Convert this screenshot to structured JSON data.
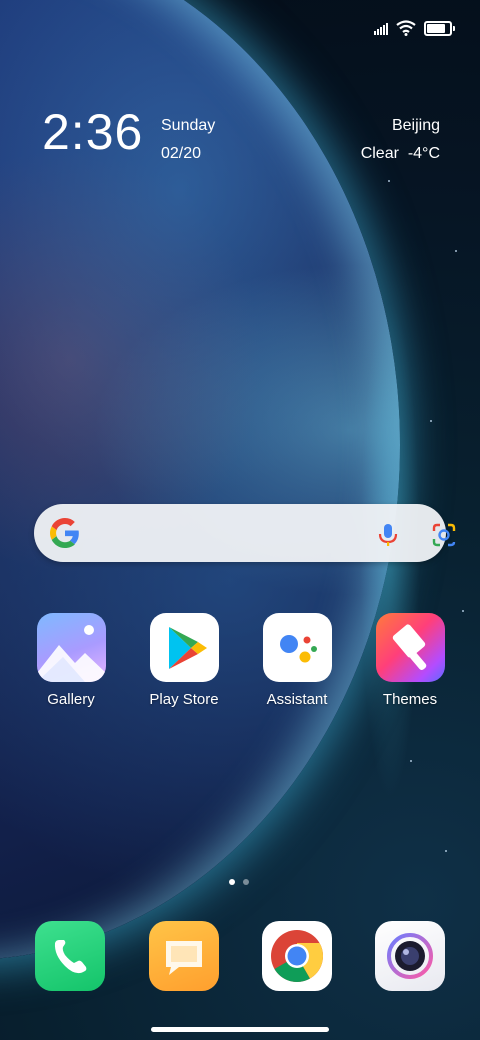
{
  "status": {
    "signal_icon": "signal-icon",
    "wifi_icon": "wifi-icon",
    "battery_icon": "battery-icon",
    "battery_level": 0.9
  },
  "clock_widget": {
    "time": "2:36",
    "day": "Sunday",
    "date": "02/20",
    "city": "Beijing",
    "weather": "Clear  -4°C"
  },
  "search_bar": {
    "logo_icon": "google-g-icon",
    "voice_icon": "microphone-icon",
    "lens_icon": "google-lens-icon"
  },
  "apps": [
    {
      "label": "Gallery",
      "icon": "gallery-icon"
    },
    {
      "label": "Play Store",
      "icon": "play-store-icon"
    },
    {
      "label": "Assistant",
      "icon": "assistant-icon"
    },
    {
      "label": "Themes",
      "icon": "themes-icon"
    }
  ],
  "page_indicator": {
    "pages": 2,
    "current": 1
  },
  "dock": [
    {
      "icon": "phone-icon"
    },
    {
      "icon": "messages-icon"
    },
    {
      "icon": "chrome-icon"
    },
    {
      "icon": "camera-icon"
    }
  ],
  "colors": {
    "phone": "#22d37a",
    "messages": "#ffb33a",
    "google_blue": "#4285F4",
    "google_red": "#EA4335",
    "google_yellow": "#FBBC05",
    "google_green": "#34A853"
  }
}
